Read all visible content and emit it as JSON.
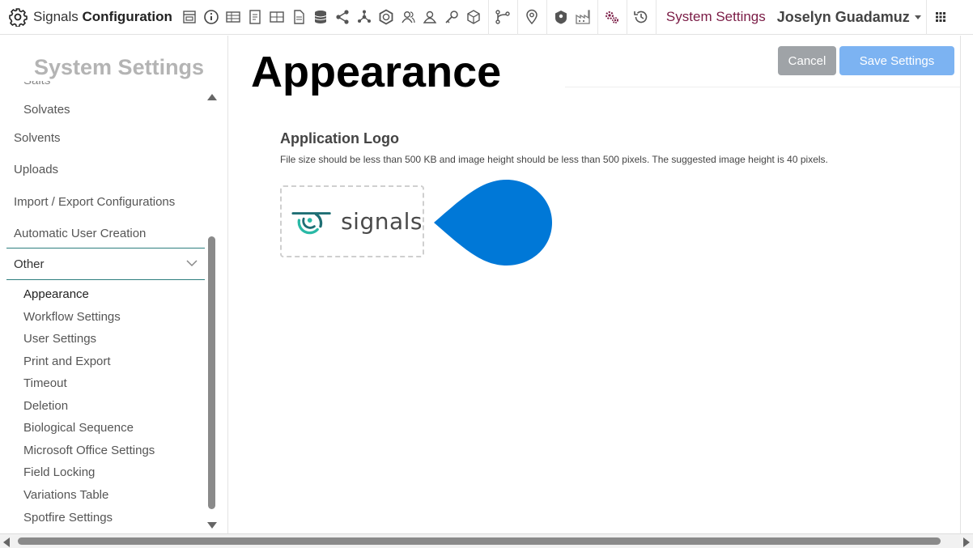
{
  "header": {
    "app_name_light": "Signals",
    "app_name_bold": "Configuration",
    "toolbar_icons": [
      "form-icon",
      "info-icon",
      "table-icon",
      "document-icon",
      "grid-table-icon",
      "file-icon",
      "database-icon",
      "share-icon",
      "network-icon",
      "hexagon-icon",
      "user-group-icon",
      "user-icon",
      "key-icon",
      "cube-icon",
      "workflow-icon",
      "location-pin-icon",
      "shield-icon",
      "factory-icon",
      "settings-cogs-icon",
      "history-icon"
    ],
    "system_settings_link": "System Settings",
    "user_name": "Joselyn Guadamuz"
  },
  "sidebar": {
    "title": "System Settings",
    "items_before": [
      {
        "label": "Salts",
        "level": "sub",
        "cut": true
      },
      {
        "label": "Solvates",
        "level": "sub"
      },
      {
        "label": "Solvents",
        "level": "top"
      },
      {
        "label": "Uploads",
        "level": "top"
      },
      {
        "label": "Import / Export Configurations",
        "level": "top"
      },
      {
        "label": "Automatic User Creation",
        "level": "top"
      }
    ],
    "group_label": "Other",
    "group_items": [
      {
        "label": "Appearance",
        "active": true
      },
      {
        "label": "Workflow Settings"
      },
      {
        "label": "User Settings"
      },
      {
        "label": "Print and Export"
      },
      {
        "label": "Timeout"
      },
      {
        "label": "Deletion"
      },
      {
        "label": "Biological Sequence"
      },
      {
        "label": "Microsoft Office Settings"
      },
      {
        "label": "Field Locking"
      },
      {
        "label": "Variations Table"
      },
      {
        "label": "Spotfire Settings"
      }
    ]
  },
  "main": {
    "title": "Appearance",
    "cancel_label": "Cancel",
    "save_label": "Save Settings",
    "section_title": "Application Logo",
    "section_desc": "File size should be less than 500 KB and image height should be less than 500 pixels. The suggested image height is 40 pixels.",
    "logo_text": "signals"
  },
  "colors": {
    "accent_teal": "#2f7f7f",
    "system_link": "#7a1b45",
    "save_button": "#7cb3f2",
    "cancel_button": "#9fa3a7",
    "drop_shape": "#0078d7"
  }
}
